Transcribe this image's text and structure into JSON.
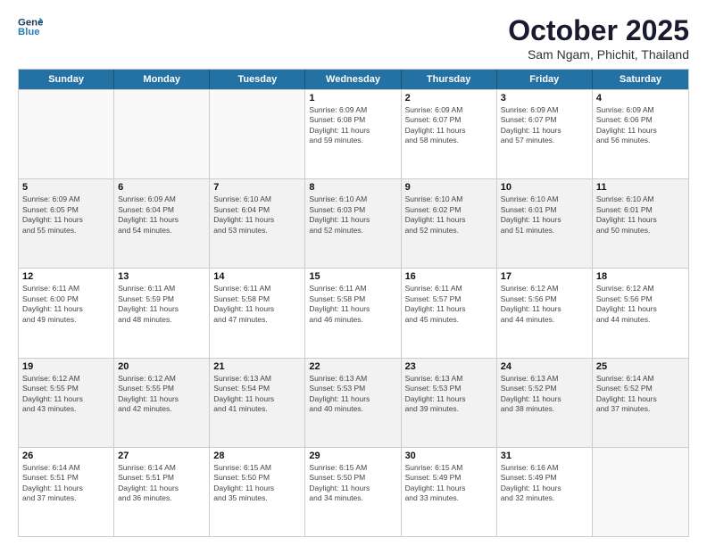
{
  "header": {
    "logo_line1": "General",
    "logo_line2": "Blue",
    "month": "October 2025",
    "location": "Sam Ngam, Phichit, Thailand"
  },
  "weekdays": [
    "Sunday",
    "Monday",
    "Tuesday",
    "Wednesday",
    "Thursday",
    "Friday",
    "Saturday"
  ],
  "rows": [
    [
      {
        "day": "",
        "info": ""
      },
      {
        "day": "",
        "info": ""
      },
      {
        "day": "",
        "info": ""
      },
      {
        "day": "1",
        "info": "Sunrise: 6:09 AM\nSunset: 6:08 PM\nDaylight: 11 hours\nand 59 minutes."
      },
      {
        "day": "2",
        "info": "Sunrise: 6:09 AM\nSunset: 6:07 PM\nDaylight: 11 hours\nand 58 minutes."
      },
      {
        "day": "3",
        "info": "Sunrise: 6:09 AM\nSunset: 6:07 PM\nDaylight: 11 hours\nand 57 minutes."
      },
      {
        "day": "4",
        "info": "Sunrise: 6:09 AM\nSunset: 6:06 PM\nDaylight: 11 hours\nand 56 minutes."
      }
    ],
    [
      {
        "day": "5",
        "info": "Sunrise: 6:09 AM\nSunset: 6:05 PM\nDaylight: 11 hours\nand 55 minutes."
      },
      {
        "day": "6",
        "info": "Sunrise: 6:09 AM\nSunset: 6:04 PM\nDaylight: 11 hours\nand 54 minutes."
      },
      {
        "day": "7",
        "info": "Sunrise: 6:10 AM\nSunset: 6:04 PM\nDaylight: 11 hours\nand 53 minutes."
      },
      {
        "day": "8",
        "info": "Sunrise: 6:10 AM\nSunset: 6:03 PM\nDaylight: 11 hours\nand 52 minutes."
      },
      {
        "day": "9",
        "info": "Sunrise: 6:10 AM\nSunset: 6:02 PM\nDaylight: 11 hours\nand 52 minutes."
      },
      {
        "day": "10",
        "info": "Sunrise: 6:10 AM\nSunset: 6:01 PM\nDaylight: 11 hours\nand 51 minutes."
      },
      {
        "day": "11",
        "info": "Sunrise: 6:10 AM\nSunset: 6:01 PM\nDaylight: 11 hours\nand 50 minutes."
      }
    ],
    [
      {
        "day": "12",
        "info": "Sunrise: 6:11 AM\nSunset: 6:00 PM\nDaylight: 11 hours\nand 49 minutes."
      },
      {
        "day": "13",
        "info": "Sunrise: 6:11 AM\nSunset: 5:59 PM\nDaylight: 11 hours\nand 48 minutes."
      },
      {
        "day": "14",
        "info": "Sunrise: 6:11 AM\nSunset: 5:58 PM\nDaylight: 11 hours\nand 47 minutes."
      },
      {
        "day": "15",
        "info": "Sunrise: 6:11 AM\nSunset: 5:58 PM\nDaylight: 11 hours\nand 46 minutes."
      },
      {
        "day": "16",
        "info": "Sunrise: 6:11 AM\nSunset: 5:57 PM\nDaylight: 11 hours\nand 45 minutes."
      },
      {
        "day": "17",
        "info": "Sunrise: 6:12 AM\nSunset: 5:56 PM\nDaylight: 11 hours\nand 44 minutes."
      },
      {
        "day": "18",
        "info": "Sunrise: 6:12 AM\nSunset: 5:56 PM\nDaylight: 11 hours\nand 44 minutes."
      }
    ],
    [
      {
        "day": "19",
        "info": "Sunrise: 6:12 AM\nSunset: 5:55 PM\nDaylight: 11 hours\nand 43 minutes."
      },
      {
        "day": "20",
        "info": "Sunrise: 6:12 AM\nSunset: 5:55 PM\nDaylight: 11 hours\nand 42 minutes."
      },
      {
        "day": "21",
        "info": "Sunrise: 6:13 AM\nSunset: 5:54 PM\nDaylight: 11 hours\nand 41 minutes."
      },
      {
        "day": "22",
        "info": "Sunrise: 6:13 AM\nSunset: 5:53 PM\nDaylight: 11 hours\nand 40 minutes."
      },
      {
        "day": "23",
        "info": "Sunrise: 6:13 AM\nSunset: 5:53 PM\nDaylight: 11 hours\nand 39 minutes."
      },
      {
        "day": "24",
        "info": "Sunrise: 6:13 AM\nSunset: 5:52 PM\nDaylight: 11 hours\nand 38 minutes."
      },
      {
        "day": "25",
        "info": "Sunrise: 6:14 AM\nSunset: 5:52 PM\nDaylight: 11 hours\nand 37 minutes."
      }
    ],
    [
      {
        "day": "26",
        "info": "Sunrise: 6:14 AM\nSunset: 5:51 PM\nDaylight: 11 hours\nand 37 minutes."
      },
      {
        "day": "27",
        "info": "Sunrise: 6:14 AM\nSunset: 5:51 PM\nDaylight: 11 hours\nand 36 minutes."
      },
      {
        "day": "28",
        "info": "Sunrise: 6:15 AM\nSunset: 5:50 PM\nDaylight: 11 hours\nand 35 minutes."
      },
      {
        "day": "29",
        "info": "Sunrise: 6:15 AM\nSunset: 5:50 PM\nDaylight: 11 hours\nand 34 minutes."
      },
      {
        "day": "30",
        "info": "Sunrise: 6:15 AM\nSunset: 5:49 PM\nDaylight: 11 hours\nand 33 minutes."
      },
      {
        "day": "31",
        "info": "Sunrise: 6:16 AM\nSunset: 5:49 PM\nDaylight: 11 hours\nand 32 minutes."
      },
      {
        "day": "",
        "info": ""
      }
    ]
  ]
}
